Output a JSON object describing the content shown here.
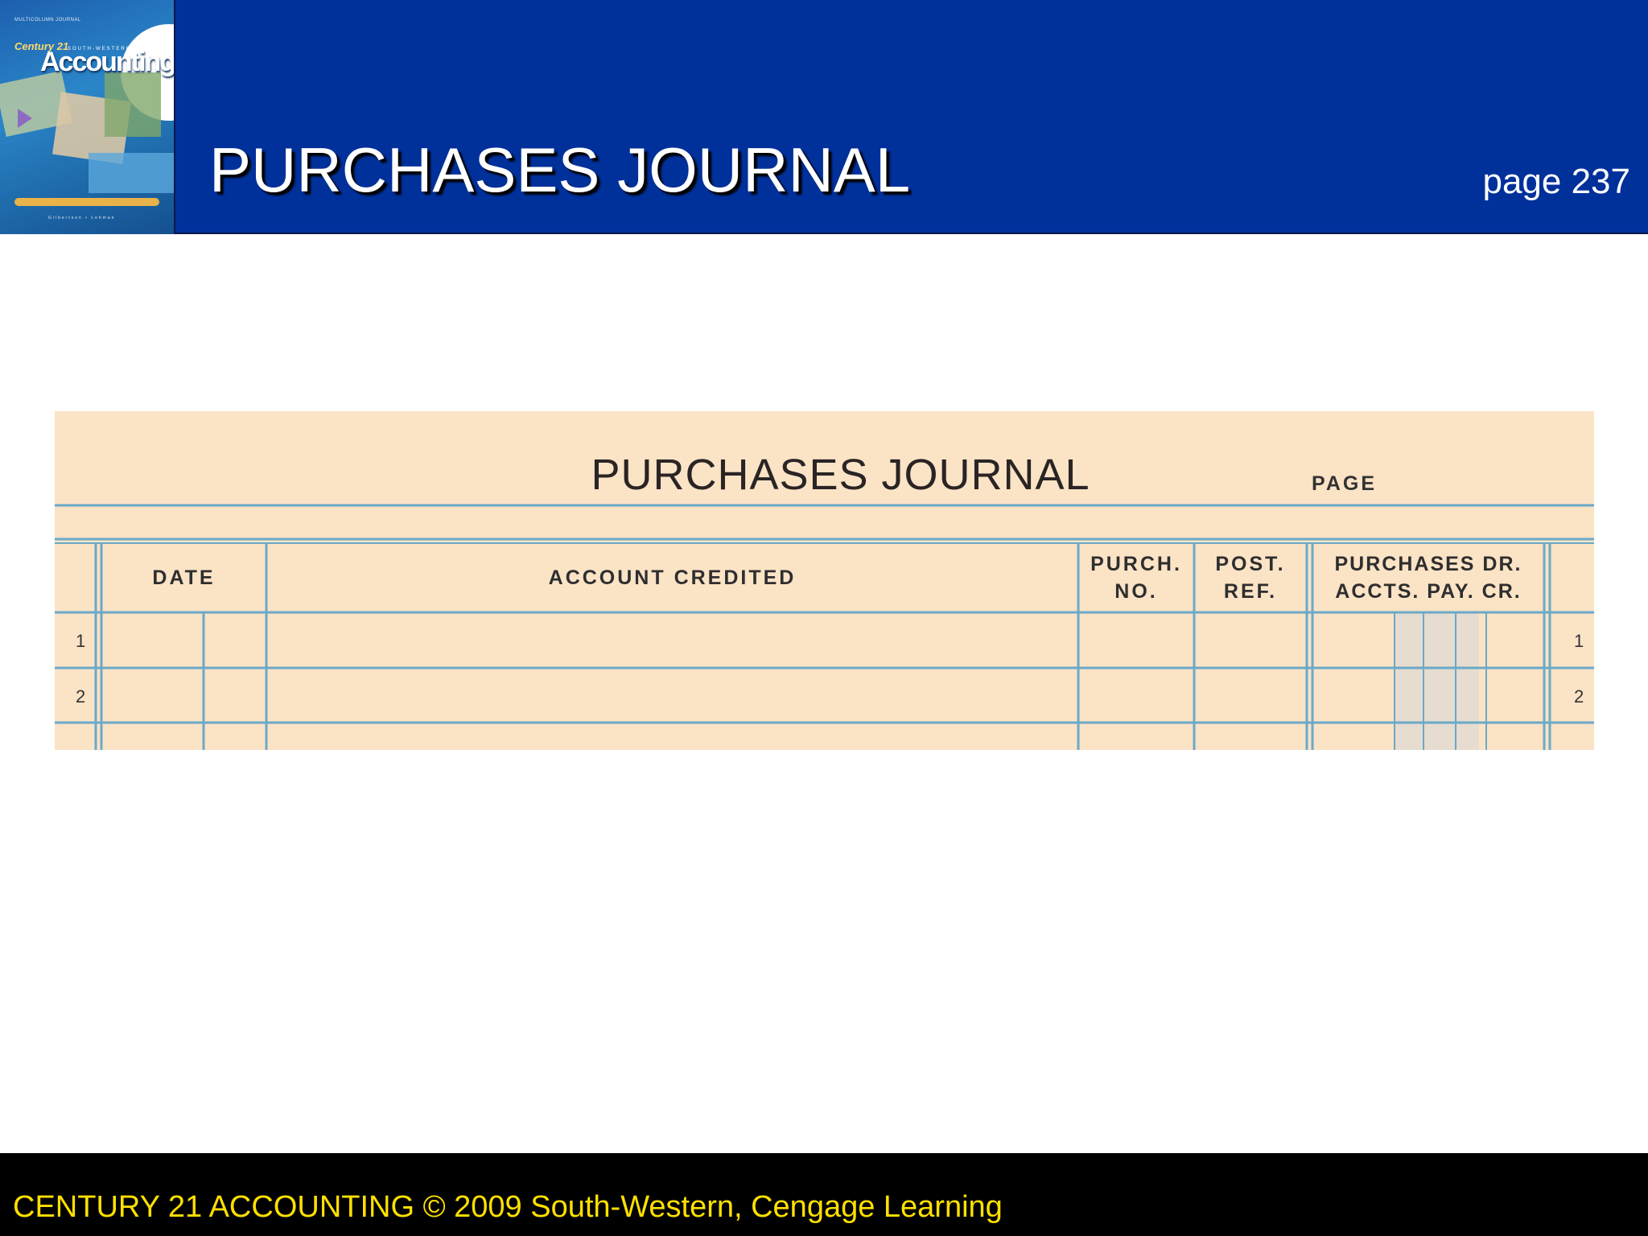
{
  "header": {
    "title": "PURCHASES JOURNAL",
    "page_ref": "page 237",
    "book_cover": {
      "top_text": "MULTICOLUMN JOURNAL",
      "series": "Century 21",
      "publisher": "SOUTH-WESTERN",
      "title": "Accounting",
      "authors": "Gilbertson • Lehman",
      "icon": "book-cover-image"
    }
  },
  "journal": {
    "title": "PURCHASES JOURNAL",
    "page_label": "PAGE",
    "columns": {
      "date": "DATE",
      "account_credited": "ACCOUNT CREDITED",
      "purch_no": [
        "PURCH.",
        "NO."
      ],
      "post_ref": [
        "POST.",
        "REF."
      ],
      "amount": [
        "PURCHASES DR.",
        "ACCTS. PAY. CR."
      ]
    },
    "rows": [
      {
        "left": "1",
        "right": "1"
      },
      {
        "left": "2",
        "right": "2"
      }
    ],
    "colors": {
      "paper": "#fbe3c6",
      "rule": "#6aa9c9",
      "shade": "#e6dcd0"
    }
  },
  "footer": {
    "text": "CENTURY 21 ACCOUNTING © 2009 South-Western, Cengage Learning"
  }
}
